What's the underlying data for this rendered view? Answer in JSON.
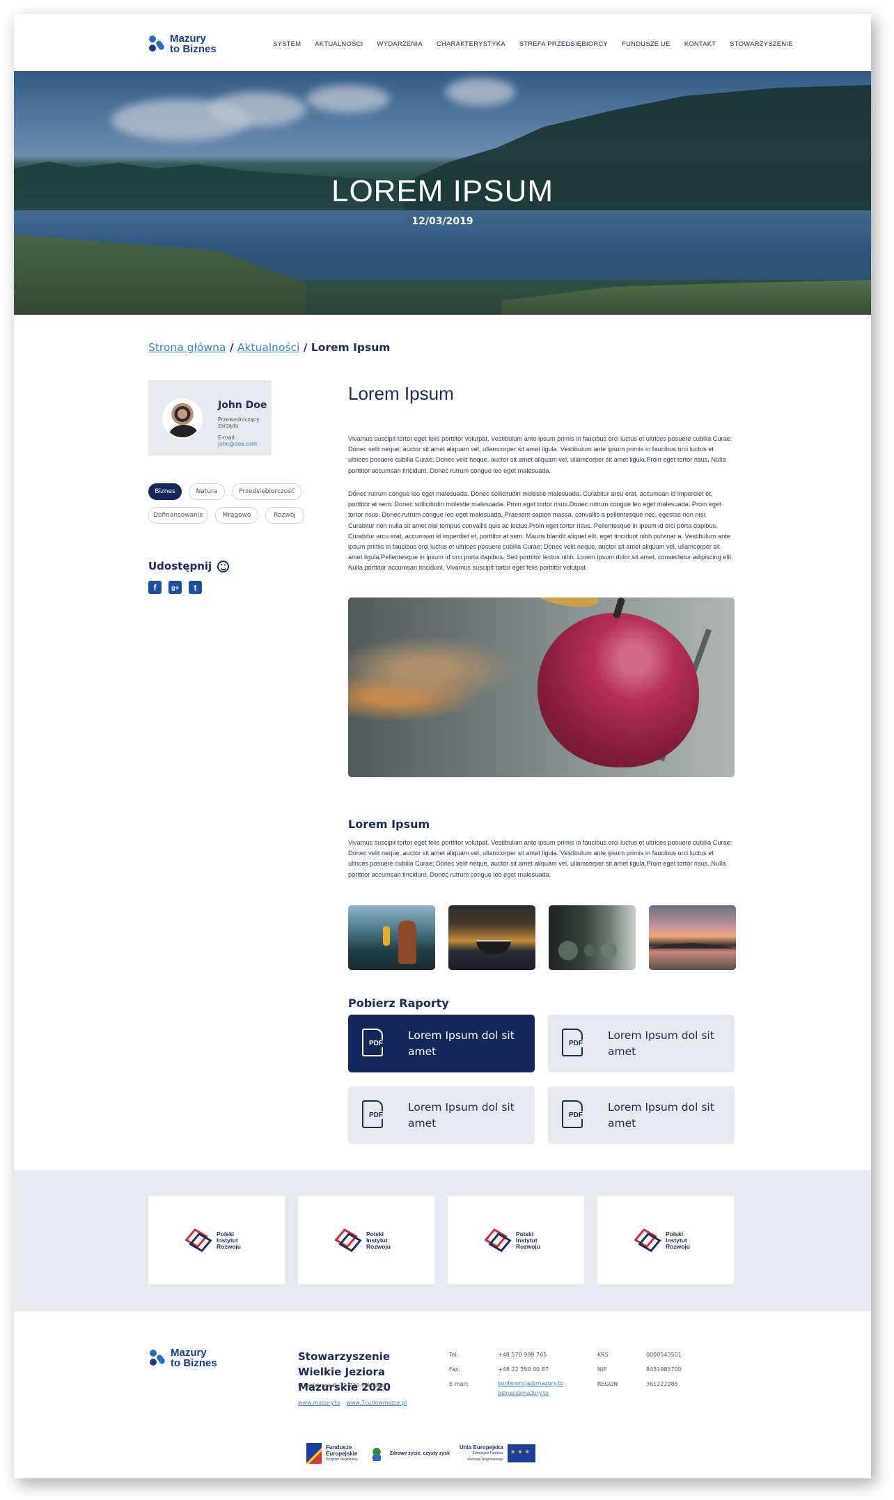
{
  "header": {
    "logo": [
      "Mazury",
      "to Biznes"
    ],
    "nav": [
      "SYSTEM",
      "AKTUALNOŚCI",
      "WYDARZENIA",
      "CHARAKTERYSTYKA",
      "STREFA PRZEDSIĘBIORCY",
      "FUNDUSZE UE",
      "KONTAKT",
      "STOWARZYSZENIE"
    ]
  },
  "hero": {
    "title": "LOREM IPSUM",
    "date": "12/03/2019"
  },
  "breadcrumb": {
    "home": "Strona główna",
    "section": "Aktualności",
    "sep": "/",
    "current": "Lorem Ipsum"
  },
  "author": {
    "name": "John Doe",
    "role": "Przewodniczący zarządu",
    "email_label": "E-mail:",
    "email": "john@doe.com"
  },
  "tags": [
    "Biznes",
    "Natura",
    "Przedsiębiorczość",
    "Dofinansowanie",
    "Mrągowo",
    "Rozwój"
  ],
  "share": {
    "label": "Udostępnij"
  },
  "social": [
    "f",
    "g+",
    "t"
  ],
  "article": {
    "title": "Lorem Ipsum",
    "p1": "Vivamus suscipit tortor eget felis porttitor volutpat. Vestibulum ante ipsum primis in faucibus orci luctus et ultrices posuere cubilia Curae; Donec velit neque, auctor sit amet aliquam vel, ullamcorper sit amet ligula. Vestibulum ante ipsum primis in faucibus orci luctus et ultrices posuere cubilia Curae; Donec velit neque, auctor sit amet aliquam vel, ullamcorper sit amet ligula.Proin eget tortor risus. Nulla porttitor accumsan tincidunt. Donec rutrum congue leo eget malesuada.",
    "p2": "Donec rutrum congue leo eget malesuada. Donec sollicitudin molestie malesuada. Curabitur arcu erat, accumsan id imperdiet et, porttitor at sem. Donec sollicitudin molestie malesuada. Proin eget tortor risus.Donec rutrum congue leo eget malesuada. Proin eget tortor risus. Donec rutrum congue leo eget malesuada. Praesent sapien massa, convallis a pellentesque nec, egestas non nisi. Curabitur non nulla sit amet nisl tempus convallis quis ac lectus.Proin eget tortor risus. Pellentesque in ipsum id orci porta dapibus. Curabitur arcu erat, accumsan id imperdiet et, porttitor at sem. Mauris blandit aliquet elit, eget tincidunt nibh pulvinar a. Vestibulum ante ipsum primis in faucibus orci luctus et ultrices posuere cubilia Curae; Donec velit neque, auctor sit amet aliquam vel, ullamcorper sit amet ligula.Pellentesque in ipsum id orci porta dapibus. Sed porttitor lectus nibh. Lorem ipsum dolor sit amet, consectetur adipiscing elit. Nulla porttitor accumsan tincidunt. Vivamus suscipit tortor eget felis porttitor volutpat.",
    "subtitle": "Lorem Ipsum",
    "p3": "Vivamus suscipit tortor eget felis porttitor volutpat. Vestibulum ante ipsum primis in faucibus orci luctus et ultrices posuere cubilia Curae; Donec velit neque, auctor sit amet aliquam vel, ullamcorper sit amet ligula. Vestibulum ante ipsum primis in faucibus orci luctus et ultrices posuere cubilia Curae; Donec velit neque, auctor sit amet aliquam vel, ullamcorper sit amet ligula.Proin eget tortor risus. Nulla porttitor accumsan tincidunt. Donec rutrum congue leo eget malesuada."
  },
  "downloads": {
    "title": "Pobierz Raporty",
    "icon_label": "PDF",
    "items": [
      "Lorem Ipsum dol sit amet",
      "Lorem Ipsum dol sit amet",
      "Lorem Ipsum dol sit amet",
      "Lorem Ipsum dol sit amet"
    ]
  },
  "partners": {
    "name": [
      "Polski",
      "Instytut",
      "Rozwoju"
    ]
  },
  "footer": {
    "org": "Stowarzyszenie Wielkie Jeziora Mazurskie 2020",
    "address": "ul. kolejowa 6, 11-730 Mikołajki",
    "links": [
      "www.mazury.to",
      "www.7cudowmazur.pl"
    ],
    "contact_labels": [
      "Tel:",
      "Fax:",
      "E-mail:"
    ],
    "contact_values": [
      "+48 570 999 765",
      "+48 22 350 00 87"
    ],
    "emails": [
      "konferencja@mazury.to",
      "biznes@mazury.to"
    ],
    "reg_labels": [
      "KRS",
      "NIP",
      "REGON"
    ],
    "reg_values": [
      "0000543501",
      "8451985700",
      "361222985"
    ],
    "funds": {
      "fe": [
        "Fundusze",
        "Europejskie",
        "Program Regionalny"
      ],
      "mz": "Zdrowe życie, czysty zysk",
      "ue": [
        "Unia Europejska",
        "Europejski Fundusz",
        "Rozwoju Regionalnego"
      ]
    }
  },
  "colors": {
    "navy": "#14275a",
    "link": "#3a82c4",
    "panel": "#e6e9ed"
  }
}
